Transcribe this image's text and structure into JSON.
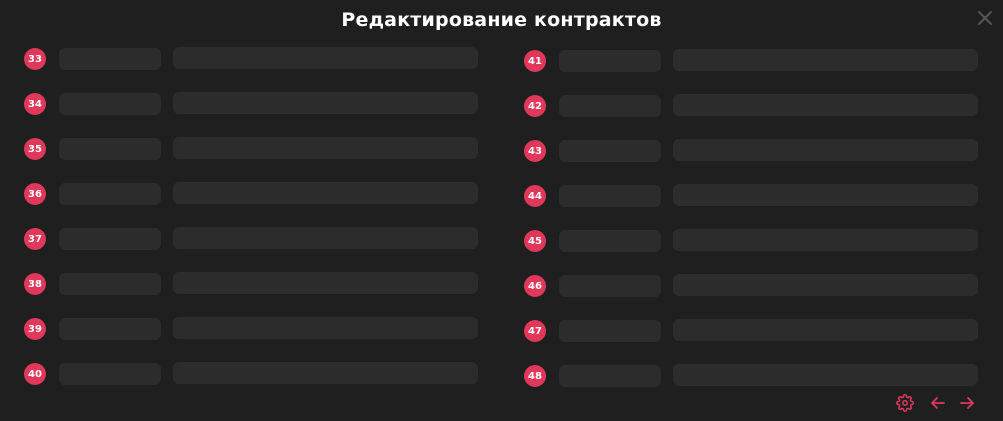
{
  "modal": {
    "title": "Редактирование контрактов"
  },
  "icons": {
    "close": "close-icon",
    "settings": "gear-icon",
    "prev": "arrow-left-icon",
    "next": "arrow-right-icon"
  },
  "colors": {
    "accent": "#e0385a",
    "background": "#1f1f1f",
    "field": "#2c2c2c",
    "close": "#555555"
  },
  "contracts": {
    "left": [
      {
        "number": "33"
      },
      {
        "number": "34"
      },
      {
        "number": "35"
      },
      {
        "number": "36"
      },
      {
        "number": "37"
      },
      {
        "number": "38"
      },
      {
        "number": "39"
      },
      {
        "number": "40"
      }
    ],
    "right": [
      {
        "number": "41"
      },
      {
        "number": "42"
      },
      {
        "number": "43"
      },
      {
        "number": "44"
      },
      {
        "number": "45"
      },
      {
        "number": "46"
      },
      {
        "number": "47"
      },
      {
        "number": "48"
      }
    ]
  }
}
